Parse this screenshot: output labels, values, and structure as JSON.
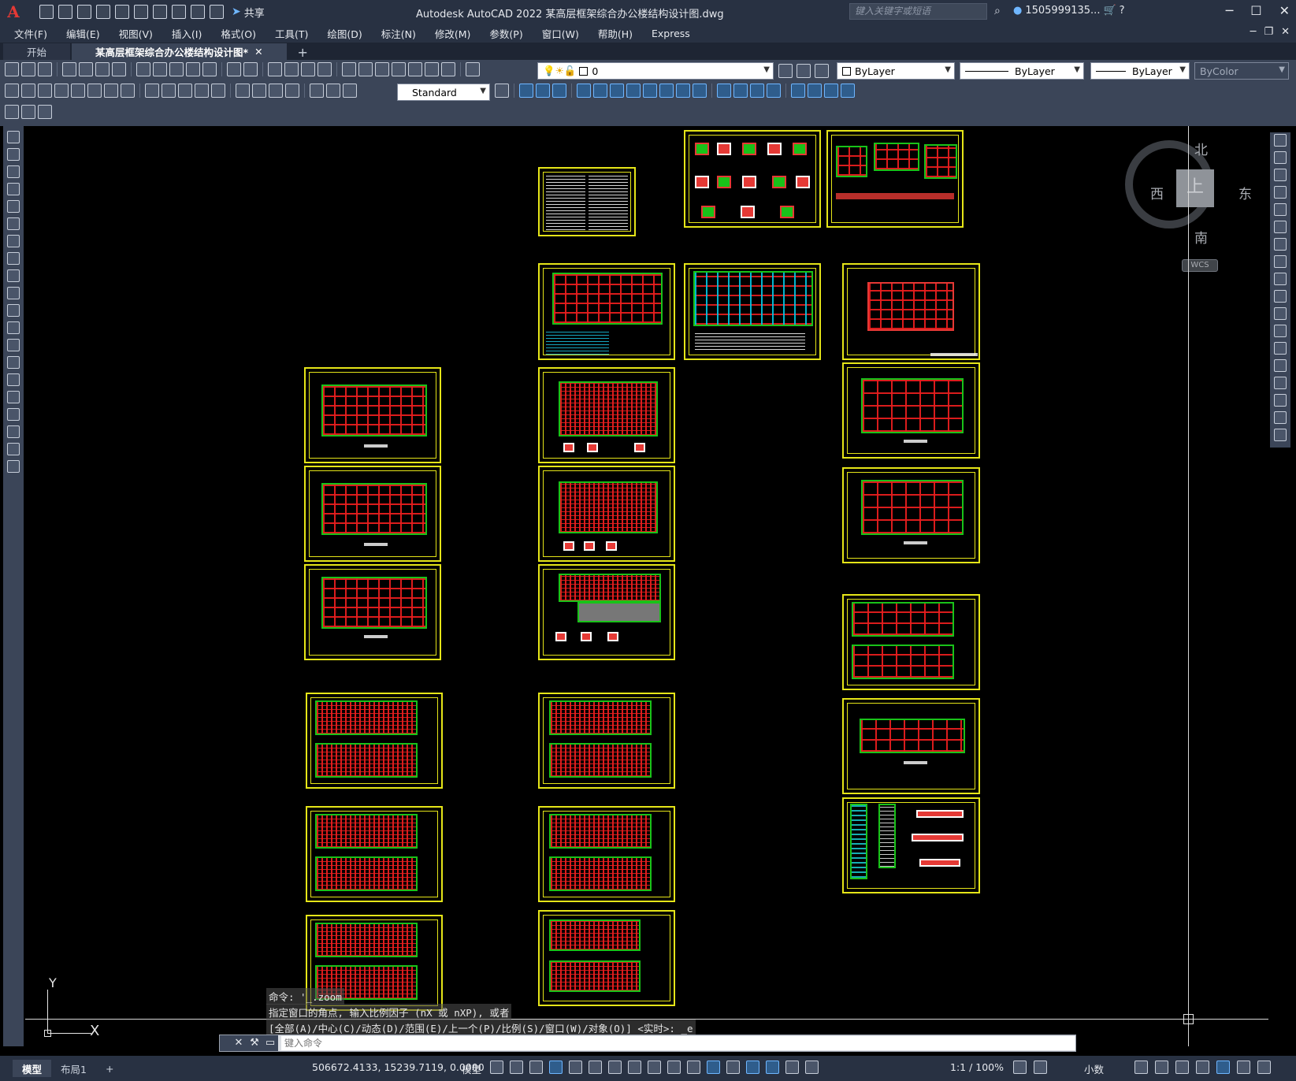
{
  "app": {
    "logo": "A",
    "window_title": "Autodesk AutoCAD 2022    某高层框架综合办公楼结构设计图.dwg",
    "share_label": "共享",
    "search_placeholder": "键入关键字或短语",
    "user_name": "1505999135...",
    "accent_color": "#e5e518"
  },
  "menu": [
    "文件(F)",
    "编辑(E)",
    "视图(V)",
    "插入(I)",
    "格式(O)",
    "工具(T)",
    "绘图(D)",
    "标注(N)",
    "修改(M)",
    "参数(P)",
    "窗口(W)",
    "帮助(H)",
    "Express"
  ],
  "tabs": {
    "start": "开始",
    "active": "某高层框架综合办公楼结构设计图*",
    "close": "✕",
    "add": "+"
  },
  "toolbar": {
    "layer_value": "0",
    "text_style": "Standard",
    "color": "ByLayer",
    "linetype": "ByLayer",
    "lineweight": "ByLayer",
    "plotstyle": "ByColor"
  },
  "viewcube": {
    "top": "上",
    "north": "北",
    "south": "南",
    "east": "东",
    "west": "西",
    "wcs": "WCS"
  },
  "ucs": {
    "x": "X",
    "y": "Y"
  },
  "command": {
    "history": [
      "命令: '_.zoom",
      "指定窗口的角点, 输入比例因子 (nX 或 nXP), 或者",
      "[全部(A)/中心(C)/动态(D)/范围(E)/上一个(P)/比例(S)/窗口(W)/对象(O)] <实时>: _e"
    ],
    "input_placeholder": "键入命令",
    "close_btn": "✕",
    "settings_btn": "🔧"
  },
  "status": {
    "model_tab": "模型",
    "layout_tab": "布局1",
    "add_layout": "+",
    "coordinates": "506672.4133, 15239.7119, 0.0000",
    "space": "模型",
    "scale": "1:1 / 100%",
    "units": "小数"
  }
}
